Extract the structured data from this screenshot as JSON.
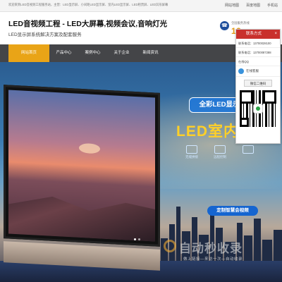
{
  "topbar": {
    "welcome": "欢迎来到LED音视频工程服务站，主营：LED显示屏、小间距LED显示屏、室内LED显示屏、LED租赁屏、LED异形屏幕",
    "links": [
      "网站地图",
      "百度地图",
      "手机站"
    ]
  },
  "header": {
    "title": "LED音视频工程 - LED大屏幕,视频会议,音响灯光",
    "subtitle": "LED显示屏系统解决方案及配套服务",
    "hotline_label": "全国服务热线",
    "hotline_number": "13"
  },
  "nav": {
    "items": [
      "网站首页",
      "产品中心",
      "案例中心",
      "关于企业",
      "新闻资讯"
    ]
  },
  "banner": {
    "slogan_box": "全彩LED显示",
    "slogan_big": "LED室内全",
    "features": [
      "无缝拼接",
      "远程控制",
      ""
    ],
    "cta": "定制智慧会视频"
  },
  "contact": {
    "title": "联系方式",
    "close": "×",
    "phone": "联系电话：13700028100",
    "mobile": "联系电话：13700087288",
    "qq_label": "在线QQ",
    "qq_service": "在线客服",
    "qr_button": "微信二维码"
  },
  "watermark": {
    "text": "自动秒收录",
    "sub": "做上链接—来访一次—自动收录"
  },
  "colors": {
    "nav_bg": "#444548",
    "nav_active": "#e9a417",
    "hotline": "#e49a15",
    "contact_head": "#c9302c",
    "cta": "#1565d0"
  }
}
